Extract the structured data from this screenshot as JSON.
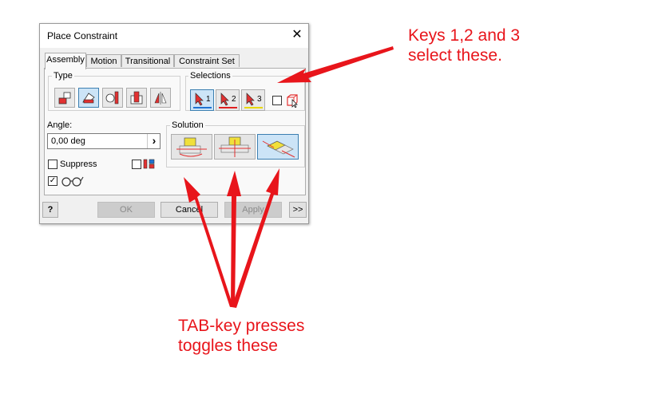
{
  "dialog": {
    "title": "Place Constraint",
    "close_glyph": "✕",
    "tabs": [
      {
        "label": "Assembly"
      },
      {
        "label": "Motion"
      },
      {
        "label": "Transitional"
      },
      {
        "label": "Constraint Set"
      }
    ],
    "type_group": {
      "label": "Type",
      "buttons": [
        "mate-icon",
        "angle-icon",
        "tangent-icon",
        "insert-icon",
        "symmetry-icon"
      ],
      "selected": 1
    },
    "selections_group": {
      "label": "Selections",
      "items": [
        {
          "label": "1",
          "color": "#1e73d2"
        },
        {
          "label": "2",
          "color": "#e02020"
        },
        {
          "label": "3",
          "color": "#e8d800"
        }
      ]
    },
    "angle": {
      "label": "Angle:",
      "value": "0,00 deg",
      "arrow": "›"
    },
    "solution_group": {
      "label": "Solution",
      "selected": 2
    },
    "suppress": {
      "label": "Suppress",
      "checked": false
    },
    "glasses": {
      "checked": true,
      "check_glyph": "✓"
    },
    "buttons": {
      "help": "?",
      "ok": "OK",
      "cancel": "Cancel",
      "apply": "Apply",
      "more": ">>"
    }
  },
  "annotations": {
    "keys_line1": "Keys 1,2 and 3",
    "keys_line2": "select these.",
    "tab_line1": "TAB-key presses",
    "tab_line2": "toggles these",
    "color": "#e8151b"
  }
}
